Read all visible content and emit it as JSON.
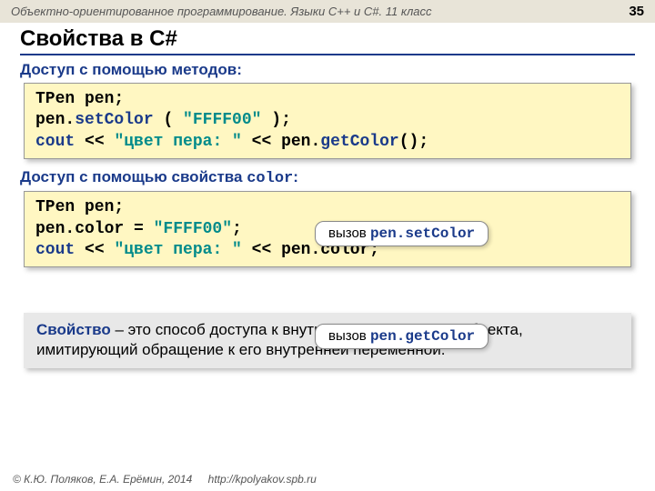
{
  "header": {
    "course": "Объектно-ориентированное программирование. Языки C++ и C#. 11 класс",
    "page": "35"
  },
  "title": "Свойства в C#",
  "section1": {
    "heading": "Доступ с помощью методов:",
    "code_l1a": "TPen pen;",
    "code_l2a": "pen.",
    "code_l2b": "setColor",
    "code_l2c": " ( ",
    "code_l2d": "\"FFFF00\"",
    "code_l2e": " );",
    "code_l3a": "cout",
    "code_l3b": " << ",
    "code_l3c": "\"цвет пера: \"",
    "code_l3d": " << pen.",
    "code_l3e": "getColor",
    "code_l3f": "();"
  },
  "section2": {
    "heading_pre": "Доступ с помощью свойства ",
    "heading_code": "color",
    "heading_post": ":",
    "code_l1a": "TPen pen;",
    "code_l2a": "pen.color = ",
    "code_l2b": "\"FFFF00\"",
    "code_l2c": ";",
    "code_l3a": "cout",
    "code_l3b": " << ",
    "code_l3c": "\"цвет пера: \"",
    "code_l3d": " << pen.color;"
  },
  "callout1": {
    "label": "вызов ",
    "code": "pen.setColor"
  },
  "callout2": {
    "label": "вызов ",
    "code": "pen.getColor"
  },
  "definition": {
    "term": "Свойство",
    "text": " – это способ доступа к внутреннему состоянию объекта, имитирующий обращение к его внутренней переменной."
  },
  "footer": {
    "copyright": "© К.Ю. Поляков, Е.А. Ерёмин, 2014",
    "url": "http://kpolyakov.spb.ru"
  }
}
